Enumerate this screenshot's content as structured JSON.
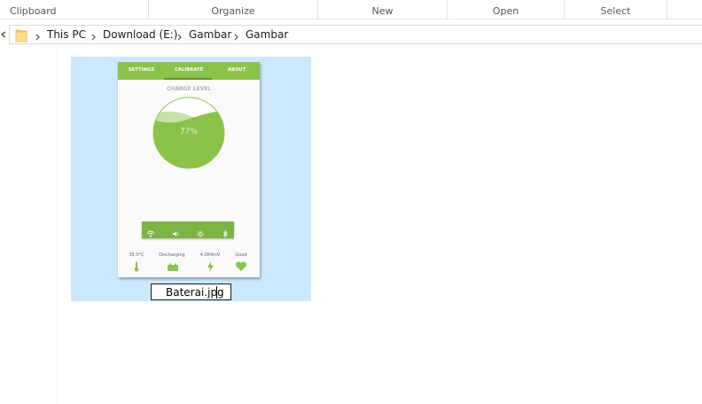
{
  "ribbon": {
    "groups": [
      "Clipboard",
      "Organize",
      "New",
      "Open",
      "Select"
    ]
  },
  "address": {
    "crumbs": [
      "This PC",
      "Download (E:)",
      "Gambar",
      "Gambar"
    ]
  },
  "file": {
    "name": "Baterai.jpg",
    "thumbnail": {
      "tabs": [
        "SETTINGS",
        "CALIBRATE",
        "ABOUT"
      ],
      "charge_label": "CHARGE LEVEL",
      "percent": "77%",
      "charge_level": 0.77,
      "controls": [
        "wifi-icon",
        "volume-icon",
        "brightness-icon",
        "bluetooth-icon"
      ],
      "stats": [
        {
          "label": "35.0°C",
          "icon": "thermometer-icon"
        },
        {
          "label": "Discharging",
          "icon": "battery-icon"
        },
        {
          "label": "4,084mV",
          "icon": "lightning-icon"
        },
        {
          "label": "Good",
          "icon": "heart-icon"
        }
      ]
    }
  },
  "colors": {
    "selection": "#cce8ff",
    "app_green": "#8bc34a",
    "app_dark_green": "#7cb342"
  }
}
